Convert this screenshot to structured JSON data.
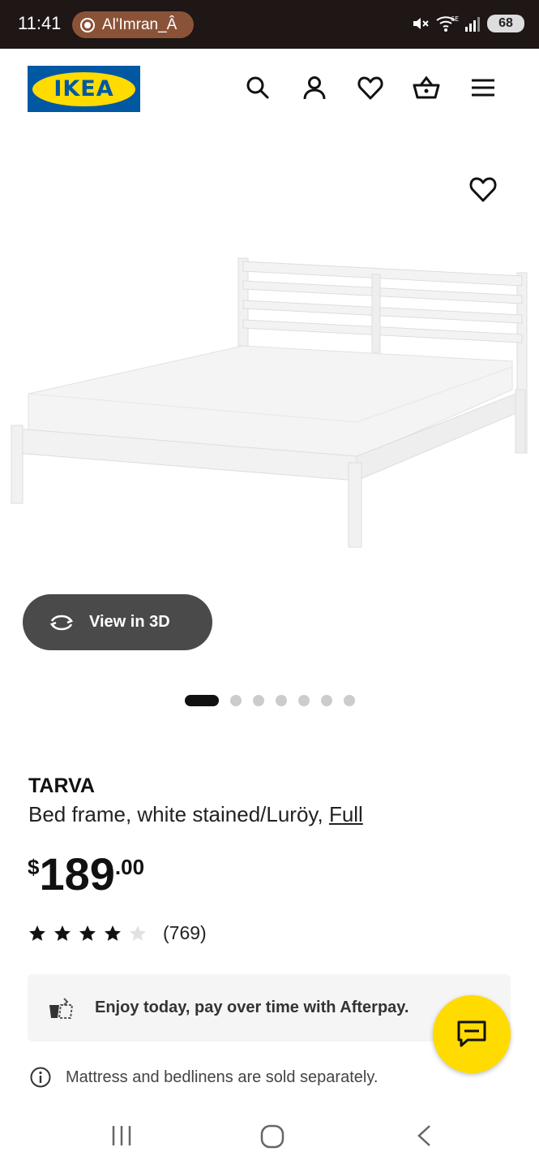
{
  "status_bar": {
    "time": "11:41",
    "app_pill": "Al'Imran_Â",
    "network": "6E",
    "battery": "68"
  },
  "header": {
    "logo_text": "IKEA",
    "icons": [
      "search-icon",
      "profile-icon",
      "heart-icon",
      "basket-icon",
      "menu-icon"
    ]
  },
  "gallery": {
    "view_3d_label": "View in 3D",
    "total_images": 7,
    "active_index": 0
  },
  "product": {
    "name": "TARVA",
    "description": "Bed frame, white stained/Luröy, ",
    "size_link": "Full",
    "price": {
      "currency": "$",
      "integer": "189",
      "decimal": ".00"
    },
    "rating": {
      "stars": 4,
      "max": 5,
      "count": "(769)"
    }
  },
  "afterpay": {
    "text": "Enjoy today, pay over time with Afterpay."
  },
  "info": {
    "text": "Mattress and bedlinens are sold separately."
  },
  "colors": {
    "ikea_blue": "#0058a3",
    "ikea_yellow": "#ffdb00",
    "view3d_bg": "#4a4a4a"
  }
}
